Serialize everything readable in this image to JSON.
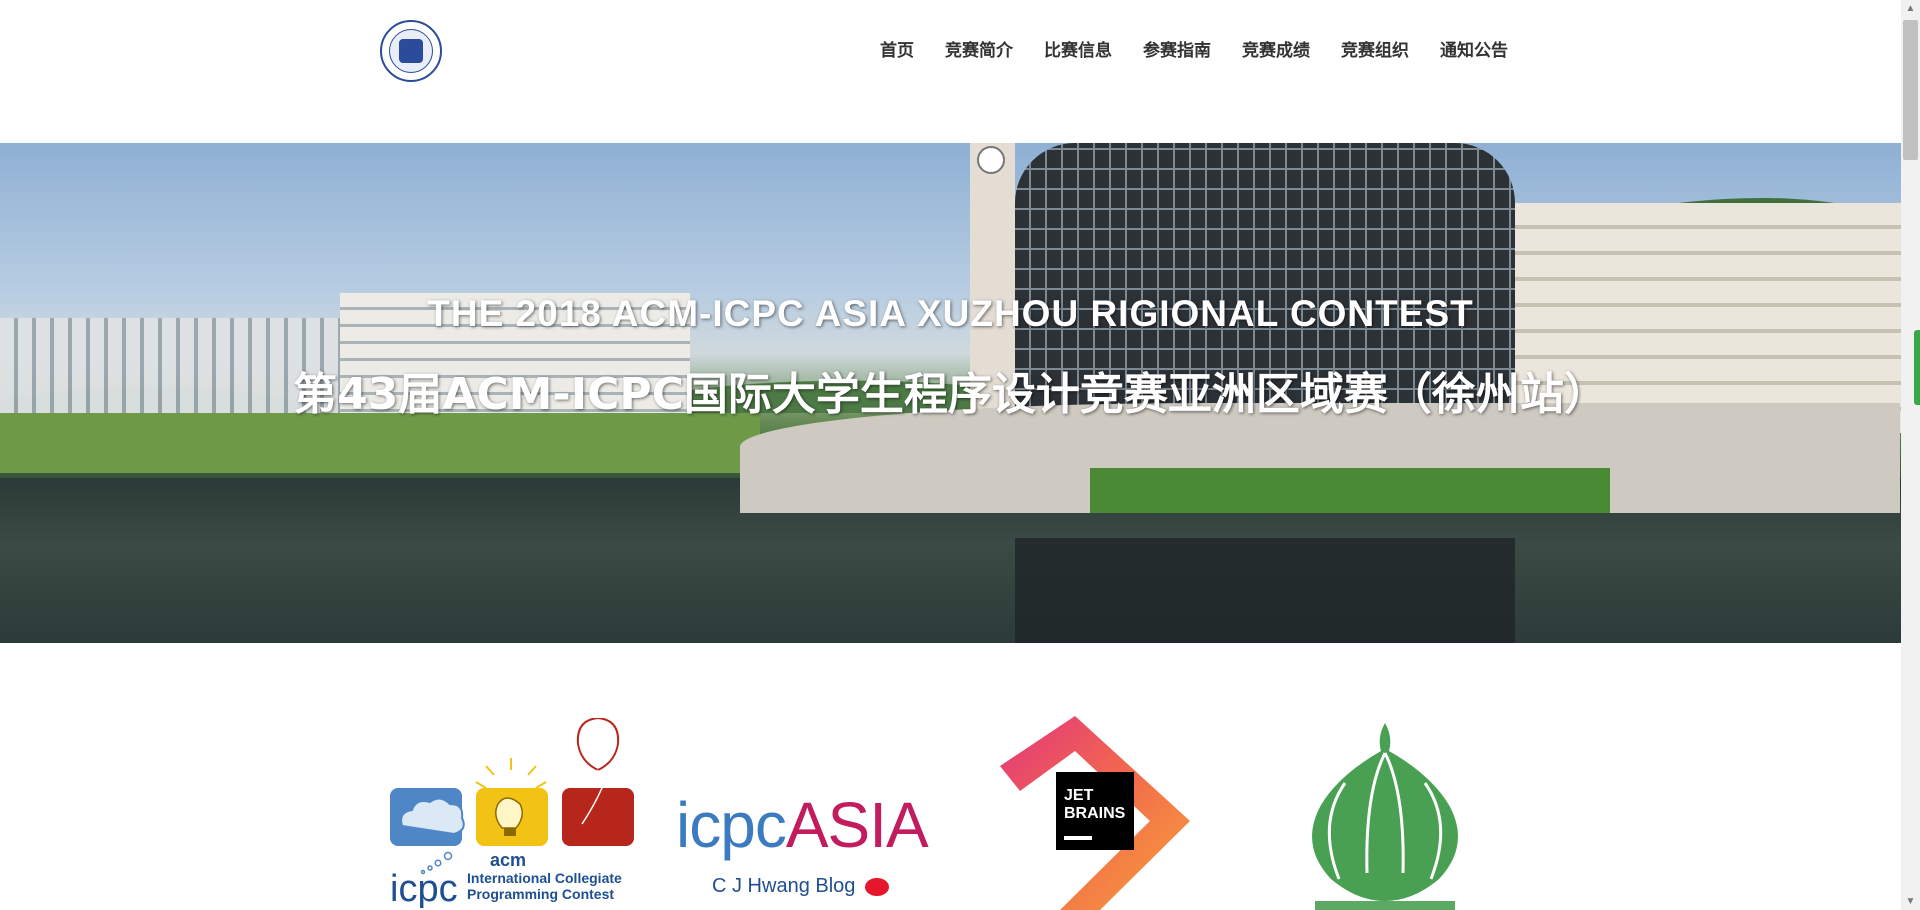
{
  "header": {
    "logo_alt": "中国矿业大学",
    "nav": [
      "首页",
      "竞赛简介",
      "比赛信息",
      "参赛指南",
      "竞赛成绩",
      "竞赛组织",
      "通知公告"
    ]
  },
  "hero": {
    "title_en": "THE 2018 ACM-ICPC ASIA XUZHOU RIGIONAL CONTEST",
    "title_cn": "第43届ACM-ICPC国际大学生程序设计竞赛亚洲区域赛（徐州站）"
  },
  "sponsors": {
    "acm": {
      "acm_text": "acm",
      "icpc_text": "icpc",
      "line1": "International Collegiate",
      "line2": "Programming Contest"
    },
    "icpc_asia": {
      "lower": "icpc",
      "upper": "ASIA"
    },
    "blog": {
      "label": "C J Hwang Blog"
    },
    "jetbrains": {
      "line1": "JET",
      "line2": "BRAINS"
    }
  },
  "colors": {
    "nav_text": "#333333",
    "icpc_blue": "#3c7bbf",
    "asia_magenta": "#c21c5e",
    "acm_blue": "#1f4f90",
    "garlic_green": "#4aa052"
  }
}
